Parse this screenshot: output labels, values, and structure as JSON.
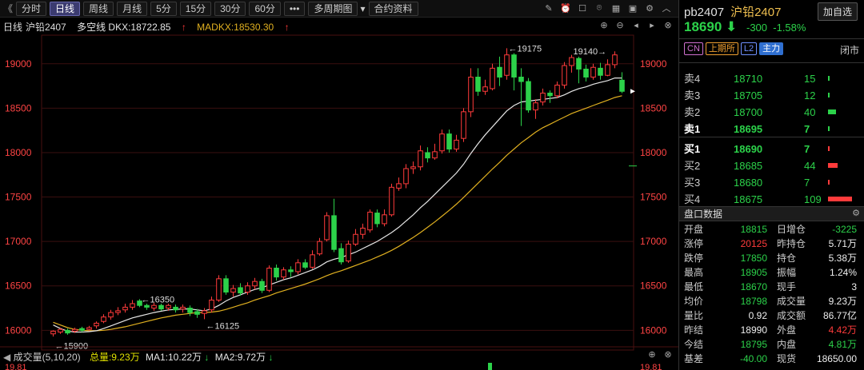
{
  "toolbar": {
    "back": "《",
    "items": [
      "分时",
      "日线",
      "周线",
      "月线",
      "5分",
      "15分",
      "30分",
      "60分",
      "•••",
      "多周期图",
      "合约资料"
    ],
    "active": "日线",
    "dropdown_items": [
      "多周期图"
    ]
  },
  "infobar": {
    "period": "日线",
    "name": "沪铅2407",
    "dk": "多空线 DKX:18722.85",
    "madk": "MADKX:18530.30"
  },
  "chart_data": {
    "type": "candlestick",
    "y_ticks": [
      "19000",
      "18500",
      "18000",
      "17500",
      "17000",
      "16500",
      "16000"
    ],
    "ylim": [
      15850,
      19250
    ],
    "annotations": [
      {
        "text": "←19175",
        "value": 19175
      },
      {
        "text": "19140→",
        "value": 19140
      },
      {
        "text": "←16350",
        "value": 16350
      },
      {
        "text": "←16125",
        "value": 16125
      },
      {
        "text": "←15900",
        "value": 15900
      }
    ],
    "candles": [
      [
        15960,
        15990,
        15930,
        16000
      ],
      [
        15980,
        16010,
        15960,
        16030
      ],
      [
        16000,
        15970,
        15950,
        16020
      ],
      [
        15990,
        16010,
        15970,
        16030
      ],
      [
        16020,
        16000,
        15980,
        16040
      ],
      [
        16010,
        16030,
        15990,
        16050
      ],
      [
        16050,
        16080,
        16020,
        16100
      ],
      [
        16100,
        16150,
        16080,
        16180
      ],
      [
        16150,
        16200,
        16120,
        16230
      ],
      [
        16200,
        16220,
        16170,
        16260
      ],
      [
        16230,
        16260,
        16200,
        16300
      ],
      [
        16260,
        16300,
        16230,
        16340
      ],
      [
        16330,
        16280,
        16260,
        16350
      ],
      [
        16280,
        16260,
        16230,
        16300
      ],
      [
        16250,
        16280,
        16220,
        16310
      ],
      [
        16280,
        16240,
        16220,
        16300
      ],
      [
        16250,
        16280,
        16220,
        16300
      ],
      [
        16260,
        16230,
        16200,
        16290
      ],
      [
        16240,
        16260,
        16200,
        16290
      ],
      [
        16250,
        16200,
        16160,
        16280
      ],
      [
        16210,
        16180,
        16140,
        16240
      ],
      [
        16190,
        16220,
        16125,
        16250
      ],
      [
        16230,
        16340,
        16200,
        16380
      ],
      [
        16340,
        16580,
        16320,
        16620
      ],
      [
        16580,
        16430,
        16400,
        16620
      ],
      [
        16430,
        16470,
        16380,
        16510
      ],
      [
        16480,
        16420,
        16390,
        16530
      ],
      [
        16430,
        16500,
        16400,
        16540
      ],
      [
        16500,
        16550,
        16460,
        16590
      ],
      [
        16550,
        16450,
        16420,
        16580
      ],
      [
        16450,
        16700,
        16430,
        16730
      ],
      [
        16700,
        16600,
        16560,
        16740
      ],
      [
        16600,
        16680,
        16570,
        16710
      ],
      [
        16680,
        16660,
        16600,
        16720
      ],
      [
        16660,
        16760,
        16630,
        16800
      ],
      [
        16760,
        16710,
        16690,
        16800
      ],
      [
        16710,
        16850,
        16690,
        16900
      ],
      [
        16860,
        17000,
        16840,
        17040
      ],
      [
        17020,
        17290,
        17000,
        17330
      ],
      [
        17290,
        16910,
        16880,
        17480
      ],
      [
        16920,
        16770,
        16740,
        16980
      ],
      [
        16780,
        16970,
        16760,
        17010
      ],
      [
        16970,
        17080,
        16950,
        17140
      ],
      [
        17080,
        17150,
        17030,
        17200
      ],
      [
        17130,
        17330,
        17100,
        17360
      ],
      [
        17320,
        17200,
        17160,
        17360
      ],
      [
        17200,
        17300,
        17170,
        17360
      ],
      [
        17300,
        17610,
        17280,
        17650
      ],
      [
        17600,
        17650,
        17570,
        17720
      ],
      [
        17650,
        17820,
        17600,
        17870
      ],
      [
        17820,
        17840,
        17760,
        17900
      ],
      [
        17840,
        18020,
        17800,
        18080
      ],
      [
        18000,
        17940,
        17890,
        18060
      ],
      [
        17940,
        18010,
        17920,
        18100
      ],
      [
        18020,
        18210,
        17990,
        18260
      ],
      [
        18210,
        18040,
        18000,
        18260
      ],
      [
        18040,
        18140,
        18010,
        18200
      ],
      [
        18160,
        18460,
        18120,
        18500
      ],
      [
        18460,
        18850,
        18400,
        18950
      ],
      [
        18850,
        18690,
        18640,
        18950
      ],
      [
        18690,
        18740,
        18650,
        18820
      ],
      [
        18720,
        18950,
        18700,
        19000
      ],
      [
        18960,
        18850,
        18750,
        19080
      ],
      [
        18870,
        19100,
        18820,
        19175
      ],
      [
        19100,
        18850,
        18700,
        19120
      ],
      [
        18850,
        18800,
        18300,
        18950
      ],
      [
        18800,
        18480,
        18450,
        18840
      ],
      [
        18480,
        18560,
        18380,
        18600
      ],
      [
        18570,
        18670,
        18530,
        18720
      ],
      [
        18670,
        18640,
        18560,
        18700
      ],
      [
        18640,
        18760,
        18610,
        18800
      ],
      [
        18760,
        18980,
        18720,
        19020
      ],
      [
        18980,
        19070,
        18900,
        19100
      ],
      [
        19060,
        18940,
        18780,
        19080
      ],
      [
        18940,
        18850,
        18800,
        18990
      ],
      [
        18850,
        18960,
        18820,
        19000
      ],
      [
        18950,
        18870,
        18820,
        19010
      ],
      [
        18870,
        18990,
        18860,
        19050
      ],
      [
        18990,
        19100,
        18950,
        19140
      ],
      [
        18815,
        18690,
        18670,
        18905
      ]
    ],
    "ma_white": [
      16060,
      16020,
      15990,
      15980,
      15980,
      15985,
      15995,
      16020,
      16050,
      16080,
      16110,
      16140,
      16160,
      16180,
      16200,
      16215,
      16230,
      16235,
      16240,
      16240,
      16230,
      16220,
      16240,
      16280,
      16330,
      16370,
      16400,
      16430,
      16460,
      16480,
      16510,
      16540,
      16570,
      16590,
      16620,
      16650,
      16680,
      16720,
      16770,
      16800,
      16820,
      16850,
      16880,
      16920,
      16960,
      17000,
      17050,
      17100,
      17160,
      17230,
      17300,
      17380,
      17450,
      17530,
      17610,
      17690,
      17770,
      17870,
      17990,
      18100,
      18200,
      18290,
      18380,
      18470,
      18530,
      18570,
      18580,
      18590,
      18600,
      18610,
      18620,
      18650,
      18690,
      18720,
      18740,
      18770,
      18790,
      18810,
      18840,
      18840
    ],
    "ma_yellow": [
      16090,
      16060,
      16030,
      16010,
      16000,
      15995,
      15995,
      16000,
      16010,
      16025,
      16040,
      16060,
      16080,
      16100,
      16120,
      16140,
      16155,
      16170,
      16180,
      16190,
      16200,
      16200,
      16205,
      16215,
      16235,
      16260,
      16285,
      16310,
      16340,
      16365,
      16390,
      16420,
      16445,
      16470,
      16495,
      16520,
      16550,
      16580,
      16615,
      16645,
      16670,
      16700,
      16730,
      16760,
      16790,
      16825,
      16860,
      16900,
      16945,
      16995,
      17045,
      17100,
      17160,
      17220,
      17285,
      17350,
      17420,
      17495,
      17575,
      17655,
      17735,
      17815,
      17890,
      17970,
      18040,
      18110,
      18170,
      18230,
      18280,
      18320,
      18360,
      18400,
      18440,
      18470,
      18500,
      18530,
      18560,
      18590,
      18620,
      18640
    ]
  },
  "volume_bar": {
    "title": "成交量(5,10,20)",
    "total": "总量:9.23万",
    "ma1": "MA1:10.22万",
    "ma2": "MA2:9.72万",
    "ytick": "19.81"
  },
  "right_panel": {
    "code": "pb2407",
    "name": "沪铅2407",
    "add_btn": "加自选",
    "price": "18690",
    "arrow": "⬇",
    "change": "-300",
    "change_pct": "-1.58%",
    "tags": [
      "CN",
      "上期所",
      "L2",
      "主力"
    ],
    "status": "闭市",
    "asks": [
      {
        "label": "卖4",
        "price": "18710",
        "vol": "15",
        "bar": 2
      },
      {
        "label": "卖3",
        "price": "18705",
        "vol": "12",
        "bar": 2
      },
      {
        "label": "卖2",
        "price": "18700",
        "vol": "40",
        "bar": 10
      },
      {
        "label": "卖1",
        "price": "18695",
        "vol": "7",
        "bar": 1
      }
    ],
    "bids": [
      {
        "label": "买1",
        "price": "18690",
        "vol": "7",
        "bar": 1
      },
      {
        "label": "买2",
        "price": "18685",
        "vol": "44",
        "bar": 12
      },
      {
        "label": "买3",
        "price": "18680",
        "vol": "7",
        "bar": 1
      },
      {
        "label": "买4",
        "price": "18675",
        "vol": "109",
        "bar": 30
      }
    ],
    "stats_title": "盘口数据",
    "stats": [
      {
        "k1": "开盘",
        "v1": "18815",
        "c1": "green",
        "k2": "日增仓",
        "v2": "-3225",
        "c2": "green"
      },
      {
        "k1": "涨停",
        "v1": "20125",
        "c1": "red",
        "k2": "昨持仓",
        "v2": "5.71万",
        "c2": "white"
      },
      {
        "k1": "跌停",
        "v1": "17850",
        "c1": "green",
        "k2": "持仓",
        "v2": "5.38万",
        "c2": "white"
      },
      {
        "k1": "最高",
        "v1": "18905",
        "c1": "green",
        "k2": "振幅",
        "v2": "1.24%",
        "c2": "white"
      },
      {
        "k1": "最低",
        "v1": "18670",
        "c1": "green",
        "k2": "现手",
        "v2": "3",
        "c2": "white"
      },
      {
        "k1": "均价",
        "v1": "18798",
        "c1": "green",
        "k2": "成交量",
        "v2": "9.23万",
        "c2": "white"
      },
      {
        "k1": "量比",
        "v1": "0.92",
        "c1": "white",
        "k2": "成交额",
        "v2": "86.77亿",
        "c2": "white"
      },
      {
        "k1": "昨结",
        "v1": "18990",
        "c1": "white",
        "k2": "外盘",
        "v2": "4.42万",
        "c2": "red"
      },
      {
        "k1": "今结",
        "v1": "18795",
        "c1": "green",
        "k2": "内盘",
        "v2": "4.81万",
        "c2": "green"
      },
      {
        "k1": "基差",
        "v1": "-40.00",
        "c1": "green",
        "k2": "现货",
        "v2": "18650.00",
        "c2": "white"
      }
    ]
  },
  "colors": {
    "up": "#ff3b3b",
    "down": "#2cd24a",
    "grid": "#3a0f0f",
    "ma_white": "#e6e6e6",
    "ma_yellow": "#e0b020",
    "axis_text": "#ff4444"
  }
}
